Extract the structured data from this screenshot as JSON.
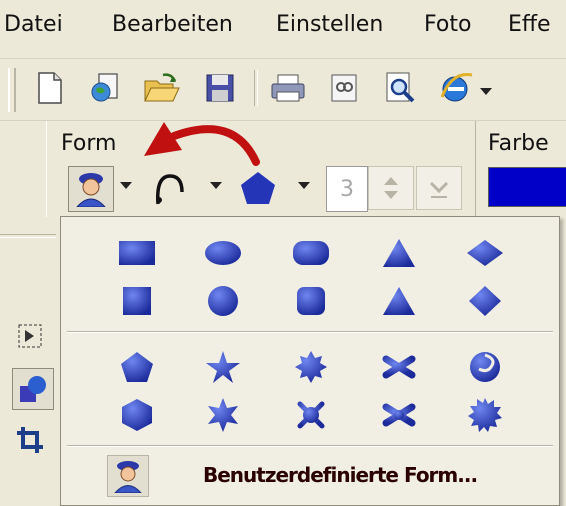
{
  "menubar": {
    "items": [
      "Datei",
      "Bearbeiten",
      "Einstellen",
      "Foto",
      "Effe"
    ]
  },
  "toolbar": {
    "buttons": [
      "new-document",
      "open-web",
      "open-folder",
      "save",
      "print",
      "scan",
      "print-preview",
      "internet-explorer"
    ]
  },
  "form_panel": {
    "form_label": "Form",
    "farbe_label": "Farbe",
    "spin_value": "3",
    "color_swatch": "#0000c8"
  },
  "dropdown": {
    "basic_shapes": [
      [
        "rectangle",
        "ellipse",
        "rounded-rectangle",
        "triangle",
        "diamond"
      ],
      [
        "square",
        "circle",
        "rounded-square",
        "triangle",
        "diamond"
      ]
    ],
    "star_shapes": [
      [
        "pentagon",
        "star-5",
        "star-8",
        "asterisk",
        "spiral"
      ],
      [
        "hexagon",
        "star-6",
        "star-12",
        "asterisk-6",
        "burst"
      ]
    ],
    "custom_label": "Benutzerdefinierte Form..."
  },
  "colors": {
    "shape_blue": "#2032a8",
    "shape_light": "#4b62d8",
    "arrow_red": "#c01010",
    "background": "#ece9d8"
  }
}
